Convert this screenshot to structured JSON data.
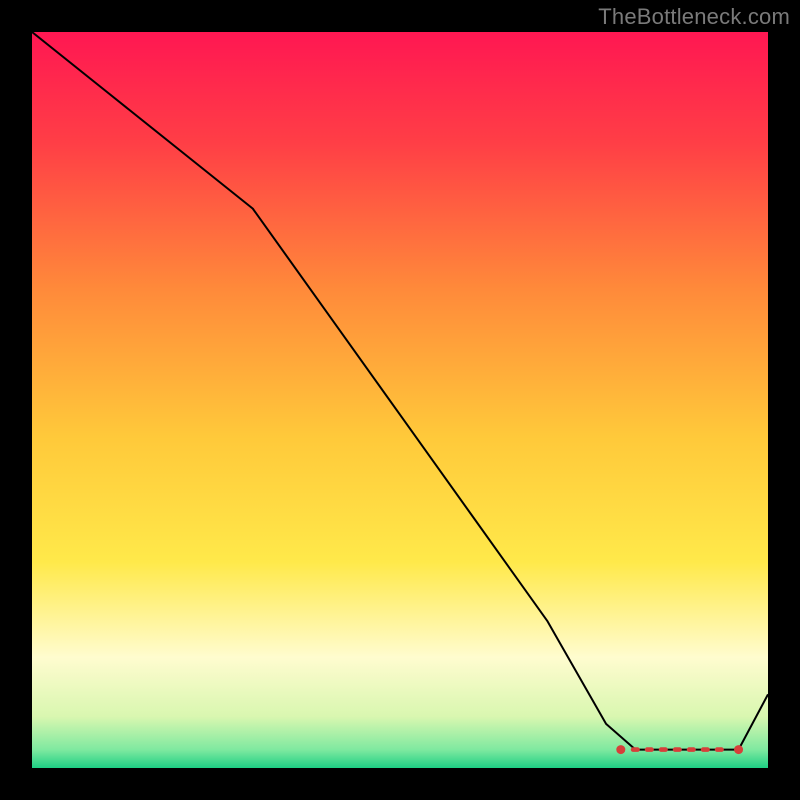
{
  "watermark": "TheBottleneck.com",
  "chart_data": {
    "type": "line",
    "title": "",
    "xlabel": "",
    "ylabel": "",
    "xlim": [
      0,
      100
    ],
    "ylim": [
      0,
      100
    ],
    "grid": false,
    "legend": false,
    "series": [
      {
        "name": "main-curve",
        "stroke": "#000000",
        "stroke_width": 2,
        "x": [
          0,
          10,
          20,
          30,
          40,
          50,
          60,
          70,
          78,
          82,
          86,
          90,
          96,
          100
        ],
        "y": [
          100,
          92,
          84,
          76,
          62,
          48,
          34,
          20,
          6,
          2.5,
          2.5,
          2.5,
          2.5,
          10
        ]
      }
    ],
    "markers": [
      {
        "name": "flat-min-dash",
        "shape": "dash-run",
        "color": "#d6403a",
        "x_start": 80,
        "x_end": 96,
        "y": 2.5
      }
    ],
    "background_gradient": {
      "stops": [
        {
          "offset": 0.0,
          "color": "#ff1752"
        },
        {
          "offset": 0.15,
          "color": "#ff3e46"
        },
        {
          "offset": 0.35,
          "color": "#ff8a3a"
        },
        {
          "offset": 0.55,
          "color": "#ffc93a"
        },
        {
          "offset": 0.72,
          "color": "#ffe94a"
        },
        {
          "offset": 0.85,
          "color": "#fffccf"
        },
        {
          "offset": 0.93,
          "color": "#d9f7b0"
        },
        {
          "offset": 0.975,
          "color": "#7fe9a0"
        },
        {
          "offset": 1.0,
          "color": "#1ecf84"
        }
      ]
    }
  }
}
